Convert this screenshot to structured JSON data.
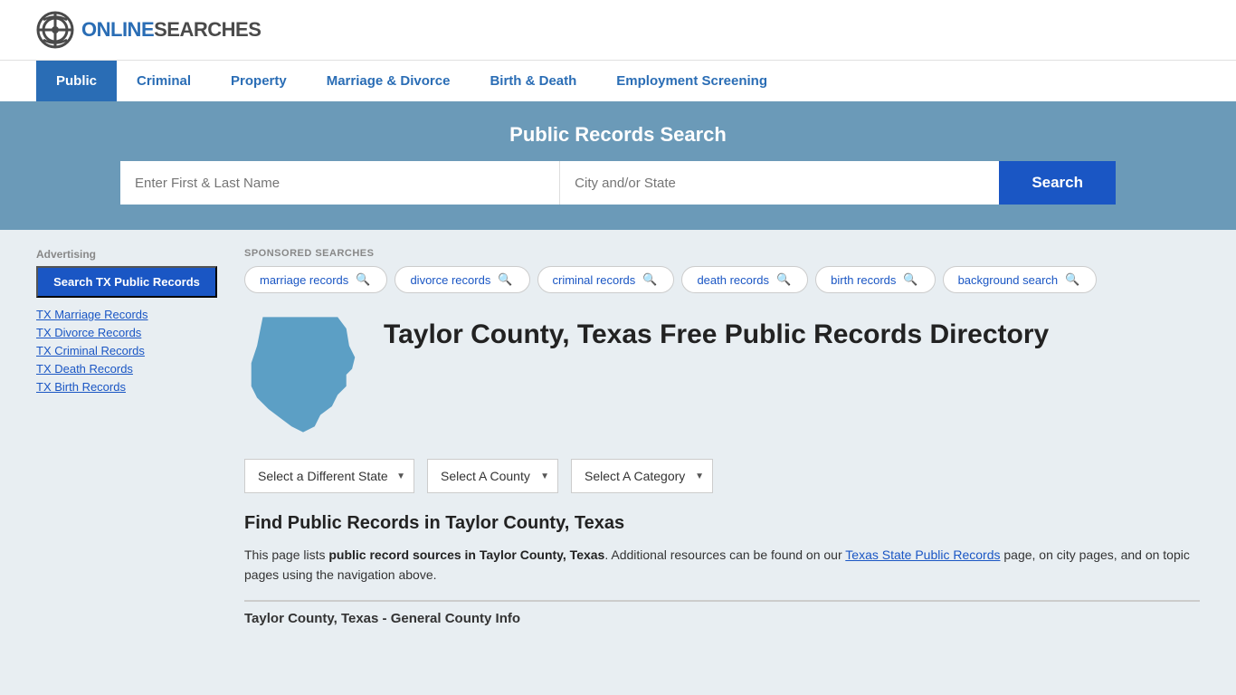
{
  "logo": {
    "text_online": "ONLINE",
    "text_searches": "SEARCHES"
  },
  "nav": {
    "items": [
      {
        "label": "Public",
        "active": true
      },
      {
        "label": "Criminal",
        "active": false
      },
      {
        "label": "Property",
        "active": false
      },
      {
        "label": "Marriage & Divorce",
        "active": false
      },
      {
        "label": "Birth & Death",
        "active": false
      },
      {
        "label": "Employment Screening",
        "active": false
      }
    ]
  },
  "search_banner": {
    "title": "Public Records Search",
    "name_placeholder": "Enter First & Last Name",
    "location_placeholder": "City and/or State",
    "button_label": "Search"
  },
  "sponsored": {
    "label": "SPONSORED SEARCHES",
    "tags": [
      "marriage records",
      "divorce records",
      "criminal records",
      "death records",
      "birth records",
      "background search"
    ]
  },
  "county": {
    "title": "Taylor County, Texas Free Public Records Directory"
  },
  "dropdowns": {
    "state": "Select a Different State",
    "county": "Select A County",
    "category": "Select A Category"
  },
  "find_section": {
    "title": "Find Public Records in Taylor County, Texas",
    "description_part1": "This page lists ",
    "description_bold": "public record sources in Taylor County, Texas",
    "description_part2": ". Additional resources can be found on our ",
    "link_text": "Texas State Public Records",
    "description_part3": " page, on city pages, and on topic pages using the navigation above."
  },
  "general_info": {
    "header": "Taylor County, Texas - General County Info"
  },
  "sidebar": {
    "ad_label": "Advertising",
    "ad_button": "Search TX Public Records",
    "links": [
      "TX Marriage Records",
      "TX Divorce Records",
      "TX Criminal Records",
      "TX Death Records",
      "TX Birth Records"
    ]
  }
}
